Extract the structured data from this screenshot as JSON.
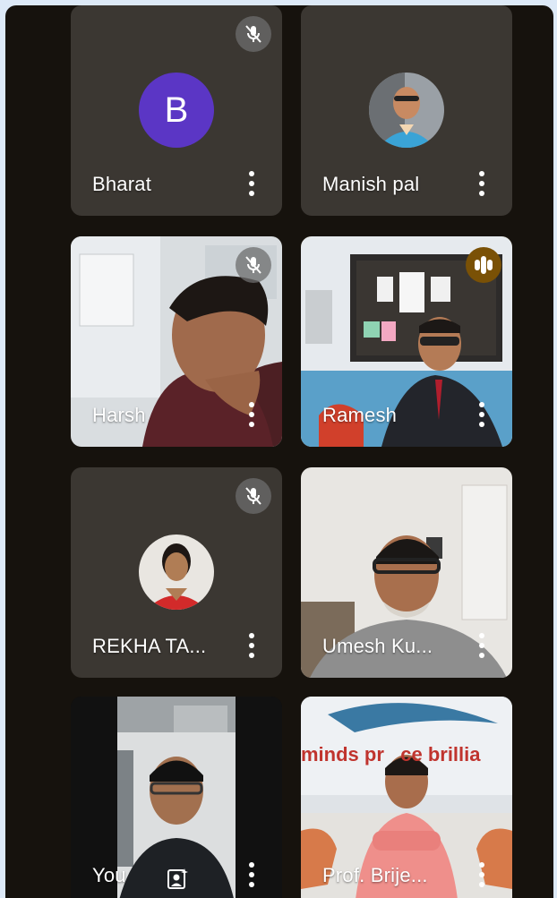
{
  "participants": [
    {
      "name": "Bharat",
      "initial": "B",
      "muted": true
    },
    {
      "name": "Manish pal",
      "muted": false
    },
    {
      "name": "Harsh",
      "muted": true
    },
    {
      "name": "Ramesh",
      "muted": false,
      "speaking": true
    },
    {
      "name": "REKHA TA...",
      "muted": true
    },
    {
      "name": "Umesh Ku...",
      "muted": false
    },
    {
      "name": "You",
      "muted": false
    },
    {
      "name": "Prof. Brije...",
      "muted": false,
      "background_text": "minds pr   ce brillia"
    }
  ],
  "icons": {
    "mute": "mic-off-icon",
    "speaking": "audio-level-icon",
    "more": "more-options-icon",
    "reframe": "portrait-frame-icon"
  },
  "colors": {
    "page_bg": "#dde9f7",
    "frame_bg": "#16120d",
    "tile_bg": "#3b3732",
    "avatar_purple": "#5b36c5",
    "speaking_gold": "#7a5a17"
  }
}
